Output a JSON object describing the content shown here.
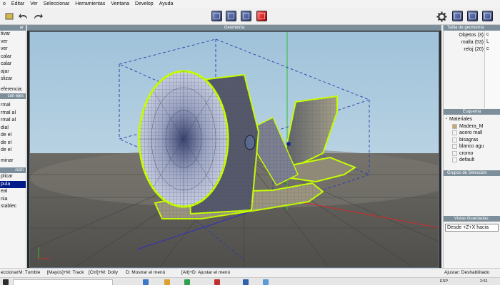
{
  "menubar": {
    "items": [
      "o",
      "Editar",
      "Ver",
      "Seleccionar",
      "Herramientas",
      "Ventana",
      "Develop",
      "Ayuda"
    ]
  },
  "toolbar": {
    "icons": [
      "undo-icon",
      "redo-icon",
      "cube-view-icon",
      "cube-shaded-icon",
      "cube-wire-icon",
      "cube-active-icon",
      "gear-icon",
      "cube-icon"
    ]
  },
  "left_panel": {
    "header1": "ar",
    "items1": [
      "tivar",
      "ver",
      "ver",
      "calar",
      "calar",
      "ajar",
      "slizar"
    ],
    "item_ref": "eferencia:",
    "header2": "con ejes",
    "items2": [
      "rmal",
      "rmal al",
      "rmal al",
      "dial",
      "de el",
      "de el",
      "de el"
    ],
    "item_min": "minar",
    "header3": "rcon",
    "items3": [
      "plicar",
      "pula",
      "eal",
      "nia",
      "stablec"
    ],
    "selected_item": "pula"
  },
  "viewport": {
    "title": "Geometría"
  },
  "right_panel": {
    "geometry_header": "Tabla de geometría",
    "geometry_rows": [
      "Objetos (3)",
      "malla (53)",
      "reloj (20)"
    ],
    "geometry_side": [
      "c",
      "L",
      "c"
    ],
    "schema_header": "Esquema",
    "materials_label": "Materiales",
    "materials": [
      {
        "name": "Madera_M",
        "color": "#c9a86a"
      },
      {
        "name": "acero mall",
        "color": "#ffffff"
      },
      {
        "name": "bisagras",
        "color": "#ffffff"
      },
      {
        "name": "blanco agu",
        "color": "#ffffff"
      },
      {
        "name": "cromo",
        "color": "#ffffff"
      },
      {
        "name": "default",
        "color": "#ffffff"
      }
    ],
    "selection_header": "Grupos de Selección",
    "saved_views_header": "Vistas Guardadas:",
    "saved_view_value": "Desde +Z+X hacia"
  },
  "statusbar": {
    "items": [
      "eccionar",
      "M: Tumble",
      "[Mayús]+M: Track",
      "[Ctrl]+M: Dolly",
      "D: Mostrar el menú",
      "[Alt]+D: Ajustar el menú"
    ],
    "right": "Ajustar: Deshabilitado"
  },
  "taskbar": {
    "lang": "ESP",
    "time": "2:51"
  },
  "colors": {
    "panel_header": "#7d8f9a",
    "selection": "#001a8a",
    "wire_highlight": "#c6ff00",
    "sky_top": "#9fc2da",
    "floor": "#5a5854"
  }
}
